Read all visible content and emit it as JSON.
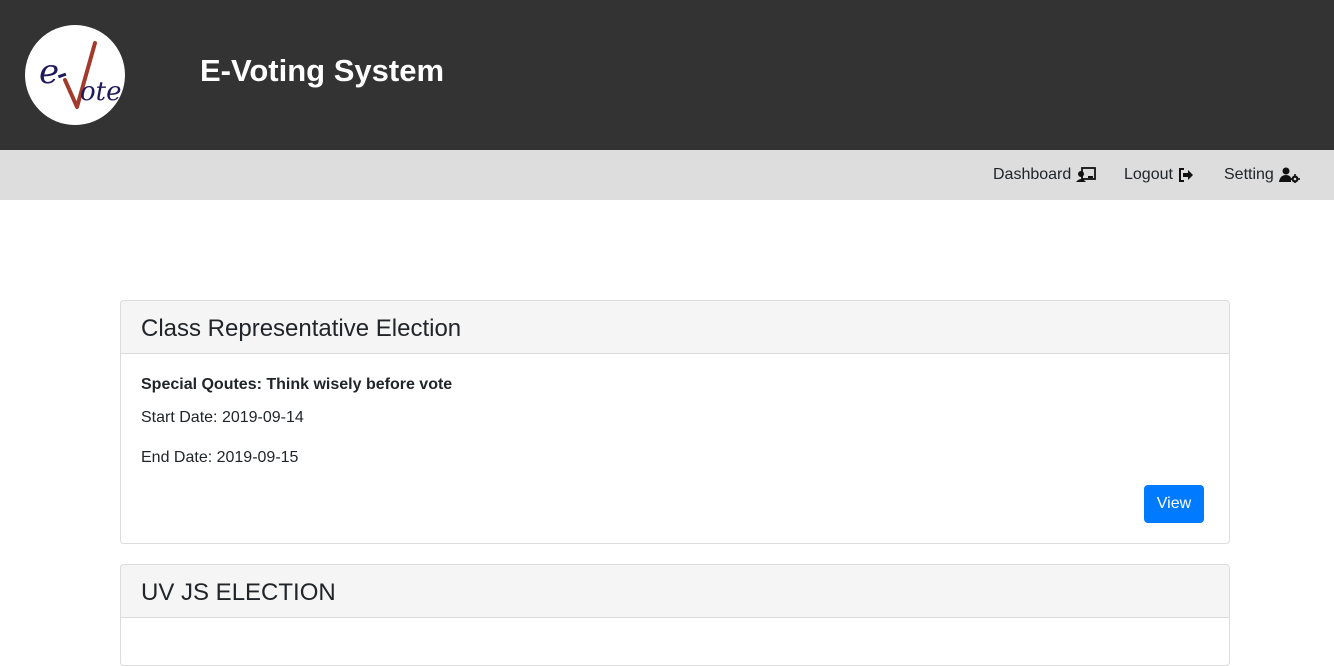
{
  "header": {
    "title": "E-Voting System",
    "logo_text": "e-vote"
  },
  "nav": {
    "items": [
      {
        "label": "Dashboard",
        "icon": "dashboard-icon"
      },
      {
        "label": "Logout",
        "icon": "logout-icon"
      },
      {
        "label": "Setting",
        "icon": "user-settings-icon"
      }
    ]
  },
  "elections": [
    {
      "title": "Class Representative Election",
      "quote_label": "Special Qoutes:",
      "quote": "Think wisely before vote",
      "start_label": "Start Date:",
      "start_date": "2019-09-14",
      "end_label": "End Date:",
      "end_date": "2019-09-15",
      "button_label": "View"
    },
    {
      "title": "UV JS ELECTION"
    }
  ],
  "colors": {
    "header_bg": "#333333",
    "navbar_bg": "#dddddd",
    "button_primary": "#007bff",
    "card_header_bg": "#f5f5f5",
    "logo_check": "#a33b2c",
    "logo_text": "#1f1a5e"
  }
}
